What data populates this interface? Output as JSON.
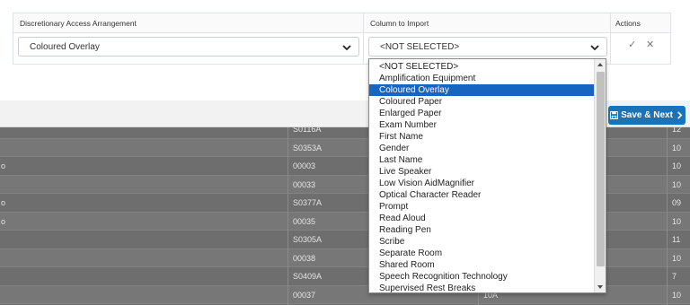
{
  "table": {
    "headers": {
      "arrangement": "Discretionary Access Arrangement",
      "column": "Column to Import",
      "actions": "Actions"
    },
    "row": {
      "arrangement_value": "Coloured Overlay",
      "column_value": "<NOT SELECTED>",
      "confirm_icon": "✓",
      "cancel_icon": "✕"
    }
  },
  "toolbar": {
    "save_label": "Save & Next"
  },
  "dropdown": {
    "options": [
      "<NOT SELECTED>",
      "Amplification Equipment",
      "Coloured Overlay",
      "Coloured Paper",
      "Enlarged Paper",
      "Exam Number",
      "First Name",
      "Gender",
      "Last Name",
      "Live Speaker",
      "Low Vision AidMagnifier",
      "Optical Character Reader",
      "Prompt",
      "Read Aloud",
      "Reading Pen",
      "Scribe",
      "Separate Room",
      "Shared Room",
      "Speech Recognition Technology",
      "Supervised Rest Breaks"
    ],
    "selected_index": 2
  },
  "background_rows": [
    {
      "lead": "",
      "code": "S0116A",
      "form": "",
      "num": "12"
    },
    {
      "lead": "",
      "code": "S0353A",
      "form": "",
      "num": "10"
    },
    {
      "lead": "o",
      "code": "00003",
      "form": "",
      "num": "10"
    },
    {
      "lead": "",
      "code": "00033",
      "form": "",
      "num": "10"
    },
    {
      "lead": "o",
      "code": "S0377A",
      "form": "",
      "num": "09"
    },
    {
      "lead": "o",
      "code": "00035",
      "form": "",
      "num": "10"
    },
    {
      "lead": "",
      "code": "S0305A",
      "form": "",
      "num": "11"
    },
    {
      "lead": "",
      "code": "00038",
      "form": "",
      "num": "10"
    },
    {
      "lead": "",
      "code": "S0409A",
      "form": "",
      "num": "7"
    },
    {
      "lead": "",
      "code": "00037",
      "form": "10A",
      "num": "10"
    }
  ]
}
